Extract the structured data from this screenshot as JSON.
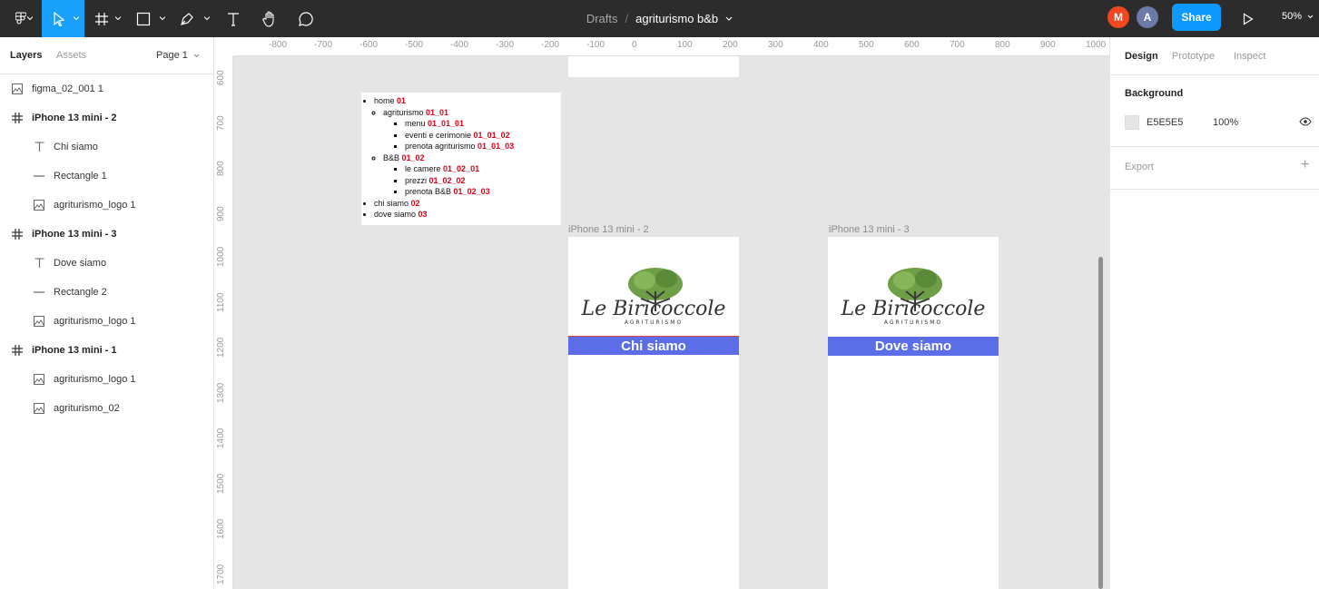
{
  "toolbar": {
    "breadcrumb": "Drafts",
    "separator": "/",
    "file_name": "agriturismo b&b",
    "share_label": "Share",
    "zoom": "50%",
    "avatars": [
      {
        "initial": "M",
        "color": "#f24822"
      },
      {
        "initial": "A",
        "color": "#6b7aa8"
      }
    ]
  },
  "left": {
    "tabs": {
      "layers": "Layers",
      "assets": "Assets",
      "page": "Page 1"
    },
    "layers": [
      {
        "label": "figma_02_001 1",
        "type": "image",
        "indent": 0
      },
      {
        "label": "iPhone 13 mini - 2",
        "type": "frame",
        "indent": 0
      },
      {
        "label": "Chi siamo",
        "type": "text",
        "indent": 1
      },
      {
        "label": "Rectangle 1",
        "type": "line",
        "indent": 1
      },
      {
        "label": "agriturismo_logo 1",
        "type": "image",
        "indent": 1
      },
      {
        "label": "iPhone 13 mini - 3",
        "type": "frame",
        "indent": 0
      },
      {
        "label": "Dove siamo",
        "type": "text",
        "indent": 1
      },
      {
        "label": "Rectangle 2",
        "type": "line",
        "indent": 1
      },
      {
        "label": "agriturismo_logo 1",
        "type": "image",
        "indent": 1
      },
      {
        "label": "iPhone 13 mini - 1",
        "type": "frame",
        "indent": 0
      },
      {
        "label": "agriturismo_logo 1",
        "type": "image",
        "indent": 1
      },
      {
        "label": "agriturismo_02",
        "type": "image",
        "indent": 1
      }
    ]
  },
  "right": {
    "tabs": {
      "design": "Design",
      "prototype": "Prototype",
      "inspect": "Inspect"
    },
    "background_label": "Background",
    "bg_hex": "E5E5E5",
    "bg_opacity": "100%",
    "export_label": "Export",
    "add_symbol": "+"
  },
  "rulers": {
    "top": [
      "-800",
      "-700",
      "-600",
      "-500",
      "-400",
      "-300",
      "-200",
      "-100",
      "0",
      "100",
      "200",
      "300",
      "400",
      "500",
      "600",
      "700",
      "800",
      "900",
      "1000"
    ],
    "left": [
      "600",
      "700",
      "800",
      "900",
      "1000",
      "1100",
      "1200",
      "1300",
      "1400",
      "1500",
      "1600",
      "1700"
    ]
  },
  "canvas": {
    "sitemap": {
      "home": "home ",
      "home_code": "01",
      "agri": "agriturismo ",
      "agri_code": "01_01",
      "menu": "menu ",
      "menu_code": "01_01_01",
      "eventi": "eventi e cerimonie ",
      "eventi_code": "01_01_02",
      "prenota_agri": "prenota agriturismo ",
      "prenota_agri_code": "01_01_03",
      "bb": "B&B ",
      "bb_code": "01_02",
      "camere": "le camere ",
      "camere_code": "01_02_01",
      "prezzi": "prezzi ",
      "prezzi_code": "01_02_02",
      "prenota_bb": "prenota B&B ",
      "prenota_bb_code": "01_02_03",
      "chi": "chi siamo ",
      "chi_code": "02",
      "dove": "dove siamo ",
      "dove_code": "03"
    },
    "frame2_name": "iPhone 13 mini - 2",
    "frame3_name": "iPhone 13 mini - 3",
    "frame2_banner": "Chi siamo",
    "frame3_banner": "Dove siamo",
    "logo_title": "Le Biricoccole",
    "logo_subtitle": "AGRITURISMO",
    "banner_color": "#5b6ee8"
  }
}
